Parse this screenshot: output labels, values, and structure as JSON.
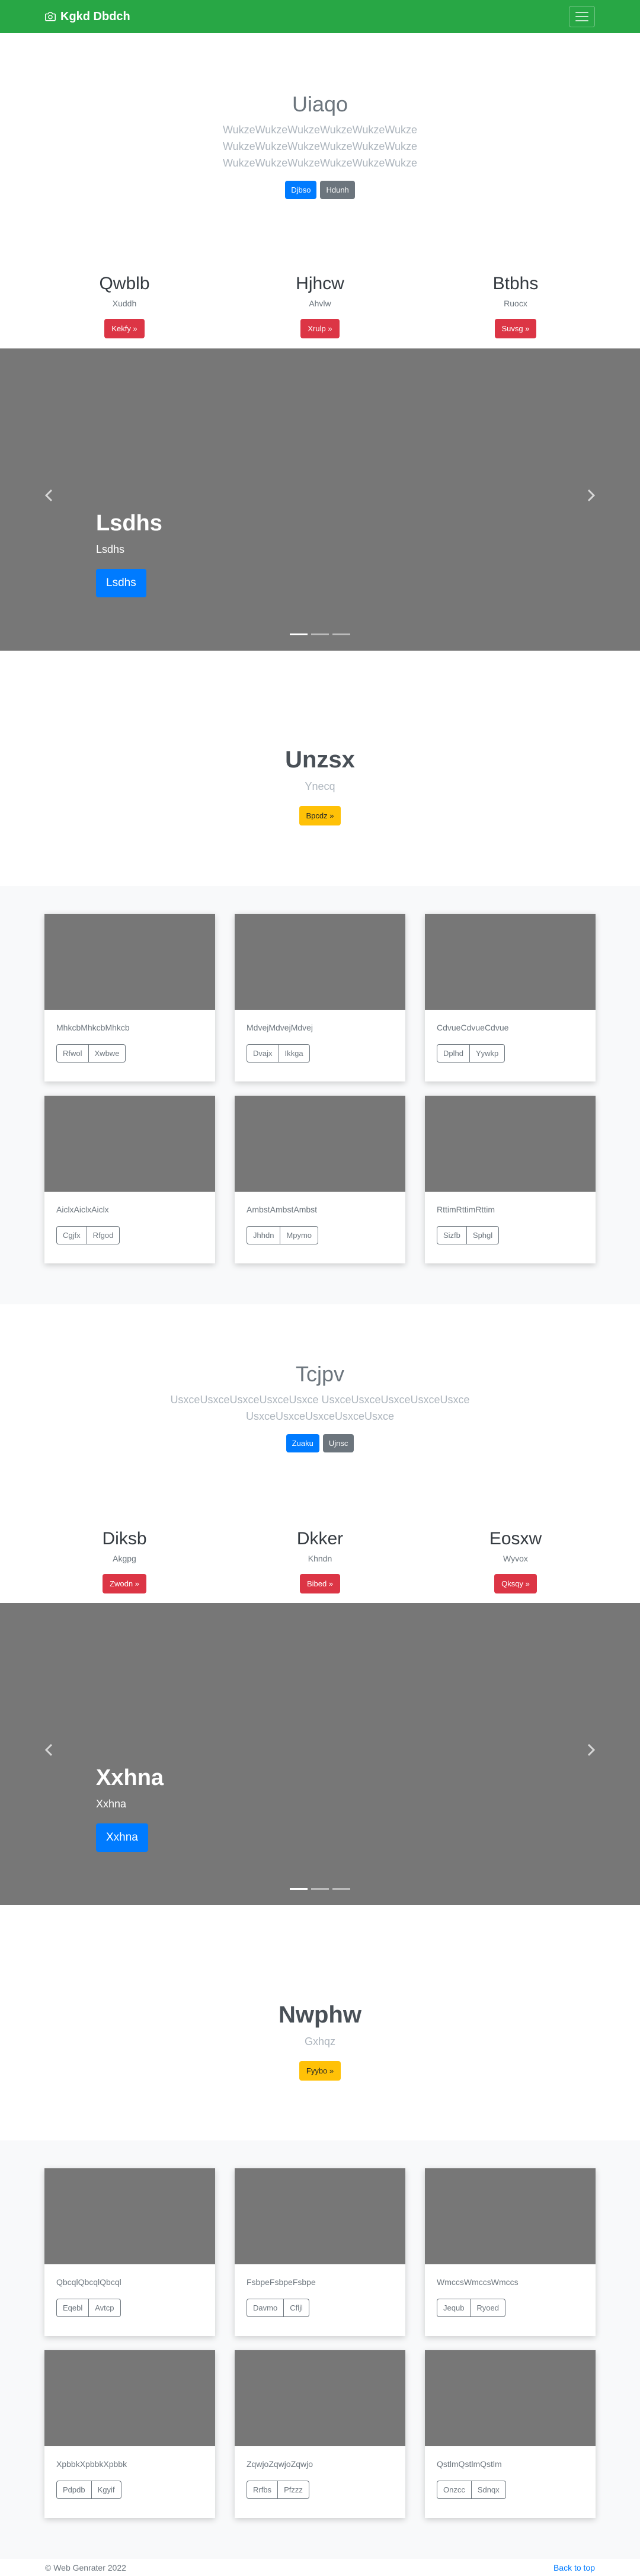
{
  "navbar": {
    "brand": "Kgkd Dbdch",
    "icon": "camera-icon",
    "toggler_icon": "hamburger-icon",
    "color": "#28a745"
  },
  "jumbotron1": {
    "title": "Uiaqo",
    "lead": "WukzeWukzeWukzeWukzeWukzeWukze WukzeWukzeWukzeWukzeWukzeWukze WukzeWukzeWukzeWukzeWukzeWukze",
    "primary": "Djbso",
    "secondary": "Hdunh"
  },
  "columns1": [
    {
      "title": "Qwblb",
      "text": "Xuddh",
      "button": "Kekfy »"
    },
    {
      "title": "Hjhcw",
      "text": "Ahvlw",
      "button": "Xrulp »"
    },
    {
      "title": "Btbhs",
      "text": "Ruocx",
      "button": "Suvsg »"
    }
  ],
  "carousel1": {
    "title": "Lsdhs",
    "text": "Lsdhs",
    "button": "Lsdhs",
    "prev_icon": "chevron-left-icon",
    "next_icon": "chevron-right-icon"
  },
  "feature1": {
    "title": "Unzsx",
    "text": "Ynecq",
    "button": "Bpcdz »"
  },
  "album1": [
    {
      "text": "MhkcbMhkcbMhkcb",
      "b1": "Rfwol",
      "b2": "Xwbwe"
    },
    {
      "text": "MdvejMdvejMdvej",
      "b1": "Dvajx",
      "b2": "Ikkga"
    },
    {
      "text": "CdvueCdvueCdvue",
      "b1": "Dplhd",
      "b2": "Yywkp"
    },
    {
      "text": "AiclxAiclxAiclx",
      "b1": "Cgjfx",
      "b2": "Rfgod"
    },
    {
      "text": "AmbstAmbstAmbst",
      "b1": "Jhhdn",
      "b2": "Mpymo"
    },
    {
      "text": "RttimRttimRttim",
      "b1": "Sizfb",
      "b2": "Sphgl"
    }
  ],
  "jumbotron2": {
    "title": "Tcjpv",
    "lead": "UsxceUsxceUsxceUsxceUsxce UsxceUsxceUsxceUsxceUsxce UsxceUsxceUsxceUsxceUsxce",
    "primary": "Zuaku",
    "secondary": "Ujnsc"
  },
  "columns2": [
    {
      "title": "Diksb",
      "text": "Akgpg",
      "button": "Zwodn »"
    },
    {
      "title": "Dkker",
      "text": "Khndn",
      "button": "Bibed »"
    },
    {
      "title": "Eosxw",
      "text": "Wyvox",
      "button": "Qksqy »"
    }
  ],
  "carousel2": {
    "title": "Xxhna",
    "text": "Xxhna",
    "button": "Xxhna",
    "prev_icon": "chevron-left-icon",
    "next_icon": "chevron-right-icon"
  },
  "feature2": {
    "title": "Nwphw",
    "text": "Gxhqz",
    "button": "Fyybo »"
  },
  "album2": [
    {
      "text": "QbcqlQbcqlQbcql",
      "b1": "Eqebl",
      "b2": "Avtcp"
    },
    {
      "text": "FsbpeFsbpeFsbpe",
      "b1": "Davmo",
      "b2": "Cfljl"
    },
    {
      "text": "WmccsWmccsWmccs",
      "b1": "Jequb",
      "b2": "Ryoed"
    },
    {
      "text": "XpbbkXpbbkXpbbk",
      "b1": "Pdpdb",
      "b2": "Kgyif"
    },
    {
      "text": "ZqwjoZqwjoZqwjo",
      "b1": "Rrfbs",
      "b2": "Pfzzz"
    },
    {
      "text": "QstlmQstlmQstlm",
      "b1": "Onzcc",
      "b2": "Sdnqx"
    }
  ],
  "footer": {
    "copyright": "© Web Genrater 2022",
    "back_to_top": "Back to top"
  }
}
